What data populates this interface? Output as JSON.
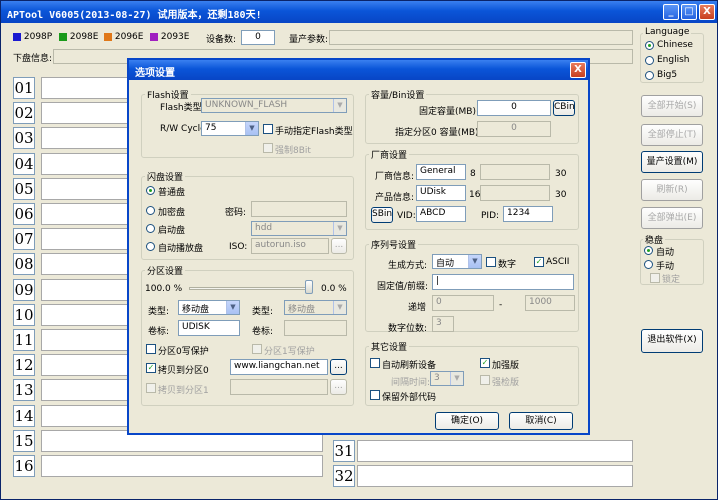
{
  "window": {
    "title": "APTool V6005(2013-08-27) 试用版本，还剩180天!",
    "min_label": "_",
    "max_label": "□",
    "close_label": "X"
  },
  "legend": [
    {
      "label": "2098P",
      "color": "#1a1ad0"
    },
    {
      "label": "2098E",
      "color": "#1a9a1a"
    },
    {
      "label": "2096E",
      "color": "#e07818"
    },
    {
      "label": "2093E",
      "color": "#a020c0"
    }
  ],
  "device_count": {
    "label": "设备数:",
    "value": "0"
  },
  "mp_params": {
    "label": "量产参数:",
    "value": ""
  },
  "download_info": {
    "label": "下盘信息:",
    "value": ""
  },
  "slots_left": [
    "01",
    "02",
    "03",
    "04",
    "05",
    "06",
    "07",
    "08",
    "09",
    "10",
    "11",
    "12",
    "13",
    "14",
    "15",
    "16"
  ],
  "slots_right": [
    "31",
    "32"
  ],
  "language": {
    "title": "Language",
    "options": [
      "Chinese",
      "English",
      "Big5"
    ],
    "selected": 0
  },
  "side_buttons": {
    "start_all": "全部开始(S)",
    "stop_all": "全部停止(T)",
    "mp_settings": "量产设置(M)",
    "refresh": "刷新(R)",
    "eject_all": "全部弹出(E)",
    "exit": "退出软件(X)"
  },
  "disk_mode": {
    "title": "稳盘",
    "auto": "自动",
    "manual": "手动",
    "lock": "锁定"
  },
  "dialog": {
    "title": "选项设置",
    "close_label": "X",
    "flash": {
      "title": "Flash设置",
      "type_label": "Flash类型:",
      "type_value": "UNKNOWN_FLASH",
      "rw_label": "R/W Cycle:",
      "rw_value": "75",
      "manual_label": "手动指定Flash类型",
      "force_label": "强制8Bit"
    },
    "disk": {
      "title": "闪盘设置",
      "normal": "普通盘",
      "encrypt": "加密盘",
      "boot": "启动盘",
      "autoplay": "自动播放盘",
      "password_label": "密码:",
      "password_value": "",
      "boot_value": "hdd",
      "iso_label": "ISO:",
      "iso_value": "autorun.iso",
      "browse": "..."
    },
    "partition": {
      "title": "分区设置",
      "left_pct": "100.0 %",
      "right_pct": "0.0 %",
      "type_label": "类型:",
      "type1_value": "移动盘",
      "type2_value": "移动盘",
      "volume_label": "卷标:",
      "volume1_value": "UDISK",
      "volume2_value": "",
      "wp0": "分区0写保护",
      "wp1": "分区1写保护",
      "copy0": "拷贝到分区0",
      "copy0_value": "www.liangchan.net",
      "copy1": "拷贝到分区1",
      "copy1_value": "",
      "browse": "..."
    },
    "capacity": {
      "title": "容量/Bin设置",
      "fixed_label": "固定容量(MB):",
      "fixed_value": "0",
      "bin_button": "CBin",
      "part0_label": "指定分区0 容量(MB):",
      "part0_value": "0"
    },
    "vendor": {
      "title": "厂商设置",
      "vendor_label": "厂商信息:",
      "vendor_value": "General",
      "vendor_len": "8",
      "vendor_max": "30",
      "product_label": "产品信息:",
      "product_value": "UDisk",
      "product_len": "16",
      "product_max": "30",
      "sbin_button": "SBin",
      "vid_label": "VID:",
      "vid_value": "ABCD",
      "pid_label": "PID:",
      "pid_value": "1234"
    },
    "serial": {
      "title": "序列号设置",
      "mode_label": "生成方式:",
      "mode_value": "自动",
      "digit_label": "数字",
      "ascii_label": "ASCII",
      "prefix_label": "固定值/前缀:",
      "prefix_value": "",
      "inc_label": "递增",
      "inc_from": "0",
      "inc_sep": "-",
      "inc_to": "1000",
      "digits_label": "数字位数:",
      "digits_value": "3"
    },
    "other": {
      "title": "其它设置",
      "auto_refresh": "自动刷新设备",
      "enhanced": "加强版",
      "interval_label": "间隔时间:",
      "interval_value": "3",
      "strong": "强检版",
      "keep_code": "保留外部代码"
    },
    "ok": "确定(O)",
    "cancel": "取消(C)"
  }
}
